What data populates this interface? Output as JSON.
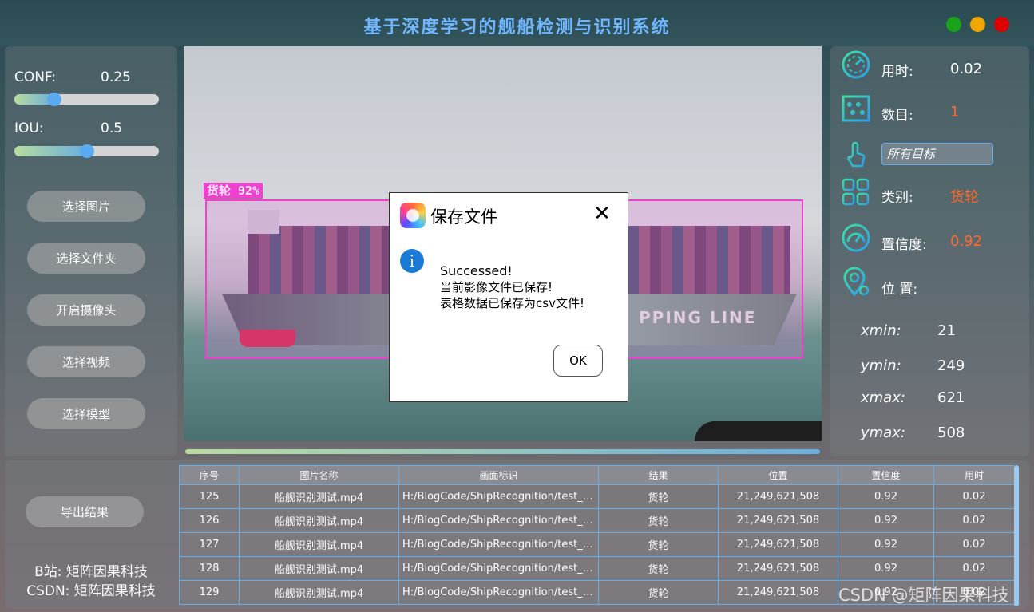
{
  "window": {
    "title": "基于深度学习的舰船检测与识别系统"
  },
  "left_panel": {
    "conf": {
      "label": "CONF:",
      "value": "0.25",
      "level": 0.25
    },
    "iou": {
      "label": "IOU:",
      "value": "0.5",
      "level": 0.5
    },
    "buttons": [
      "选择图片",
      "选择文件夹",
      "开启摄像头",
      "选择视频",
      "选择模型"
    ]
  },
  "detection": {
    "label": "货轮 92%",
    "ship_text": "PPING LINE"
  },
  "dialog": {
    "title": "保存文件",
    "line1": "Successed!",
    "line2": "当前影像文件已保存!",
    "line3": "表格数据已保存为csv文件!",
    "ok_label": "OK",
    "close_symbol": "✕",
    "info_symbol": "i"
  },
  "right_panel": {
    "time_label": "用时:",
    "time_value": "0.02",
    "count_label": "数目:",
    "count_value": "1",
    "target_select": "所有目标",
    "class_label": "类别:",
    "class_value": "货轮",
    "conf_label": "置信度:",
    "conf_value": "0.92",
    "pos_label": "位 置:",
    "xmin_label": "xmin:",
    "xmin_value": "21",
    "ymin_label": "ymin:",
    "ymin_value": "249",
    "xmax_label": "xmax:",
    "xmax_value": "621",
    "ymax_label": "ymax:",
    "ymax_value": "508"
  },
  "bottom": {
    "export_label": "导出结果",
    "credit_bili": "B站: 矩阵因果科技",
    "credit_csdn": "CSDN: 矩阵因果科技",
    "watermark": "CSDN @矩阵因果科技"
  },
  "table": {
    "headers": [
      "序号",
      "图片名称",
      "画面标识",
      "结果",
      "位置",
      "置信度",
      "用时"
    ],
    "rows": [
      [
        "125",
        "船舰识别测试.mp4",
        "H:/BlogCode/ShipRecognition/test_m...",
        "货轮",
        "21,249,621,508",
        "0.92",
        "0.02"
      ],
      [
        "126",
        "船舰识别测试.mp4",
        "H:/BlogCode/ShipRecognition/test_m...",
        "货轮",
        "21,249,621,508",
        "0.92",
        "0.02"
      ],
      [
        "127",
        "船舰识别测试.mp4",
        "H:/BlogCode/ShipRecognition/test_m...",
        "货轮",
        "21,249,621,508",
        "0.92",
        "0.02"
      ],
      [
        "128",
        "船舰识别测试.mp4",
        "H:/BlogCode/ShipRecognition/test_m...",
        "货轮",
        "21,249,621,508",
        "0.92",
        "0.02"
      ],
      [
        "129",
        "船舰识别测试.mp4",
        "H:/BlogCode/ShipRecognition/test_m...",
        "货轮",
        "21,249,621,508",
        "0.92",
        "0.02"
      ]
    ]
  },
  "colors": {
    "accent_blue": "#6fb6ff",
    "value_orange": "#ff6a2a",
    "detection_pink": "#f040d0"
  }
}
